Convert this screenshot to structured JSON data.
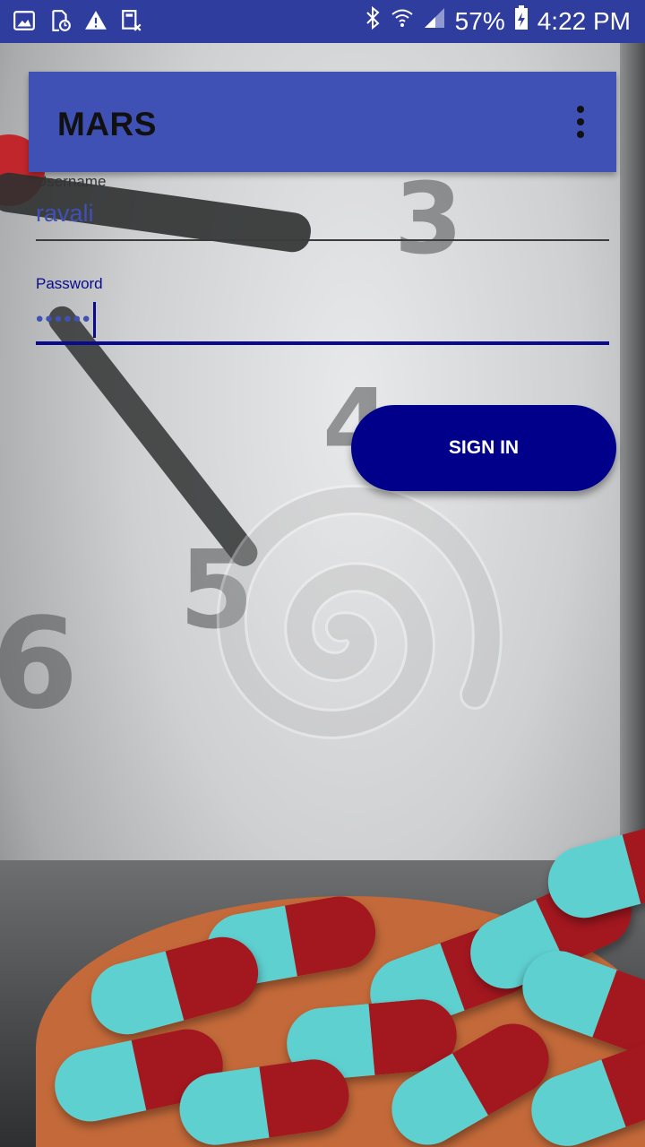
{
  "status_bar": {
    "battery": "57%",
    "time": "4:22 PM"
  },
  "app_bar": {
    "title": "MARS",
    "overflow_icon": "more-vert-icon"
  },
  "form": {
    "username_label": "Username",
    "username_value": "ravali",
    "password_label": "Password",
    "password_value": "••••••"
  },
  "signin_button": {
    "label": "SIGN IN"
  },
  "colors": {
    "status_bar": "#2f3e9e",
    "app_bar": "#3f51b5",
    "primary_dark": "#00008b"
  }
}
